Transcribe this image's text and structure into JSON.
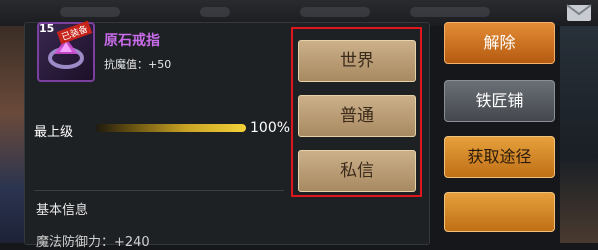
{
  "item": {
    "level": "15",
    "badge": "已装备",
    "name": "原石戒指",
    "stat": "抗魔值：+50"
  },
  "level": {
    "label": "最上级",
    "progress_percent": 100,
    "percent_text": "100%"
  },
  "section": {
    "basic_info": "基本信息",
    "partial_line": "魔法防御力：+240"
  },
  "chat_buttons": [
    "世界",
    "普通",
    "私信"
  ],
  "actions": {
    "unequip": "解除",
    "blacksmith": "铁匠铺",
    "obtain": "获取途径",
    "fourth": ""
  },
  "colors": {
    "highlight_box": "#e0161c",
    "item_name": "#c96bea",
    "action_orange": "#d2781f"
  },
  "icons": {
    "mail": "mail-icon",
    "ring": "ring-icon"
  }
}
